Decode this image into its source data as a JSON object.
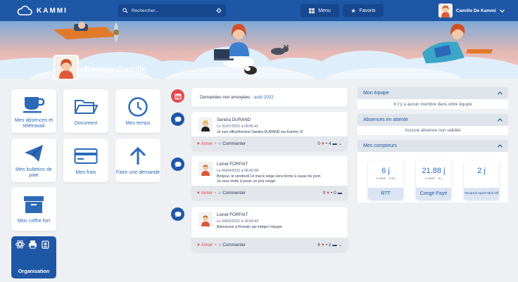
{
  "app": {
    "logo_text": "KAMMI"
  },
  "search": {
    "placeholder": "Rechercher..."
  },
  "nav": {
    "menu_label": "Menu",
    "favorites_label": "Favoris"
  },
  "user": {
    "name": "Camille De Kammi"
  },
  "greeting": "Bonjour Camille",
  "tiles": [
    {
      "label": "Mes absences et télétravail",
      "icon": "coffee-cup-icon"
    },
    {
      "label": "Document",
      "icon": "folder-icon"
    },
    {
      "label": "Mes temps",
      "icon": "clock-icon"
    },
    {
      "label": "Mes bulletins de paie",
      "icon": "paper-plane-icon"
    },
    {
      "label": "Mes frais",
      "icon": "credit-card-icon"
    },
    {
      "label": "Faire une demande",
      "icon": "arrow-up-icon"
    },
    {
      "label": "Mon coffre fort",
      "icon": "archive-box-icon"
    },
    {
      "label": "Organisation",
      "icon": "organisation-icons"
    }
  ],
  "feed": {
    "pending_label": "Demandes non envoyées :",
    "pending_month": "août 2022",
    "posts": [
      {
        "author": "Sandra DURAND",
        "date": "Le 31/07/2021 à 09:55:41",
        "text": "Je suis officiellement Sandra DURAND sur Kammi :D",
        "like_label": "Aimer",
        "comment_label": "Commenter",
        "likes": "0",
        "comments": "4"
      },
      {
        "author": "Lionel FORFAIT",
        "date": "Le 06/04/2022 à 08:43:08",
        "text": "Bonjour, le vendredi 14 mai le siège sera fermé à cause du pont. Je vous invite à poser un jour congé.",
        "like_label": "Aimer",
        "comment_label": "Commenter",
        "likes": "0",
        "comments": "0"
      },
      {
        "author": "Lionel FORFAIT",
        "date": "Le 24/03/2021 à 18:00:44",
        "text": "Bienvenue à Romain qui intègre l'équipe",
        "like_label": "Aimer",
        "comment_label": "Commenter",
        "likes": "6",
        "comments": "2"
      }
    ]
  },
  "panels": {
    "team": {
      "title": "Mon équipe",
      "empty": "Il n'y a aucun membre dans votre équipe"
    },
    "absences": {
      "title": "Absences en attente",
      "empty": "Aucune absence non validée"
    },
    "counters": {
      "title": "Mes compteurs",
      "items": [
        {
          "value": "6 j",
          "sub": "A venir : -3.5 j",
          "label": "RTT"
        },
        {
          "value": "21.88 j",
          "sub": "A venir : -6 j",
          "label": "Congé Payé"
        },
        {
          "value": "2 j",
          "sub": "",
          "label": "Vendredi Après-Midi Off"
        }
      ]
    }
  },
  "colors": {
    "primary": "#1f57a7",
    "accent": "#e14a4a",
    "page_bg": "#eef0f4"
  }
}
